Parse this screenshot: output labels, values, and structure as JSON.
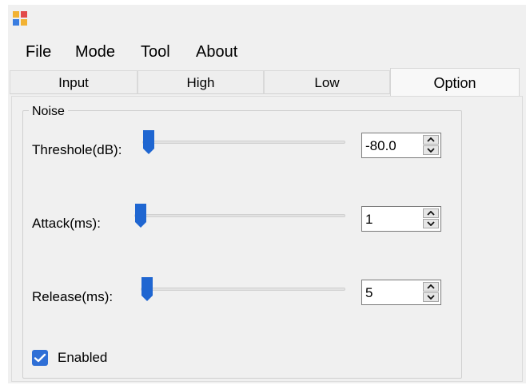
{
  "menu": {
    "items": [
      "File",
      "Mode",
      "Tool",
      "About"
    ]
  },
  "tabs": {
    "items": [
      "Input",
      "High",
      "Low",
      "Option"
    ],
    "active": "Option"
  },
  "noise": {
    "title": "Noise",
    "rows": [
      {
        "label": "Threshole(dB):",
        "value": "-80.0",
        "slider_fraction": 0.0
      },
      {
        "label": "Attack(ms):",
        "value": "1",
        "slider_fraction": 0.0
      },
      {
        "label": "Release(ms):",
        "value": "5",
        "slider_fraction": 0.02
      }
    ],
    "enabled": {
      "label": "Enabled",
      "checked": true
    }
  },
  "colors": {
    "accent": "#2f6fd6"
  },
  "icons": {
    "app": "app-icon",
    "spin_up": "chevron-up-icon",
    "spin_down": "chevron-down-icon",
    "checkbox": "checkmark-icon"
  }
}
